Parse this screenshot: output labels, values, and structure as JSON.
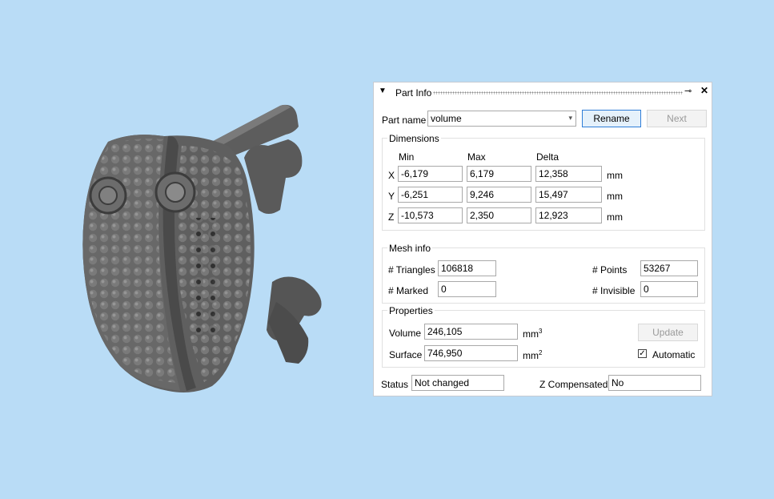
{
  "panel": {
    "title": "Part Info",
    "pin_glyph": "⊸",
    "close_glyph": "✕",
    "part_name_label": "Part name",
    "part_name_value": "volume",
    "rename_label": "Rename",
    "next_label": "Next",
    "dimensions": {
      "title": "Dimensions",
      "col_min": "Min",
      "col_max": "Max",
      "col_delta": "Delta",
      "unit": "mm",
      "rows": [
        {
          "axis": "X",
          "min": "-6,179",
          "max": "6,179",
          "delta": "12,358"
        },
        {
          "axis": "Y",
          "min": "-6,251",
          "max": "9,246",
          "delta": "15,497"
        },
        {
          "axis": "Z",
          "min": "-10,573",
          "max": "2,350",
          "delta": "12,923"
        }
      ]
    },
    "mesh_info": {
      "title": "Mesh info",
      "triangles_label": "# Triangles",
      "triangles_value": "106818",
      "points_label": "# Points",
      "points_value": "53267",
      "marked_label": "# Marked",
      "marked_value": "0",
      "invisible_label": "# Invisible",
      "invisible_value": "0"
    },
    "properties": {
      "title": "Properties",
      "volume_label": "Volume",
      "volume_value": "246,105",
      "volume_unit": "mm",
      "volume_unit_exp": "3",
      "surface_label": "Surface",
      "surface_value": "746,950",
      "surface_unit": "mm",
      "surface_unit_exp": "2",
      "update_label": "Update",
      "automatic_label": "Automatic",
      "automatic_checked": true
    },
    "status_label": "Status",
    "status_value": "Not changed",
    "zcomp_label": "Z Compensated",
    "zcomp_value": "No"
  }
}
